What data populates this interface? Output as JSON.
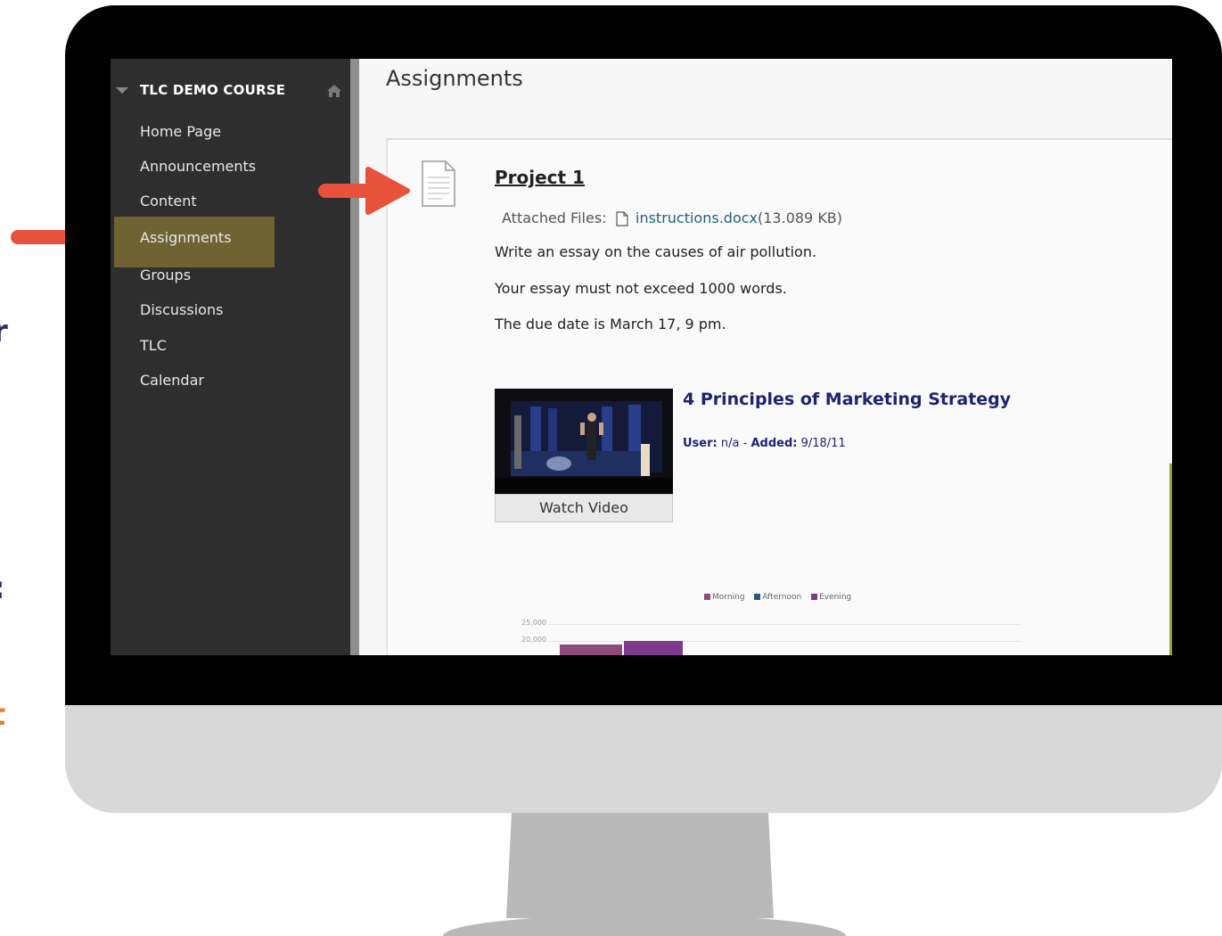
{
  "sidebar": {
    "course_title": "TLC DEMO COURSE",
    "items": [
      {
        "label": "Home Page"
      },
      {
        "label": "Announcements"
      },
      {
        "label": "Content"
      },
      {
        "label": "Assignments",
        "active": true
      },
      {
        "label": "Groups"
      },
      {
        "label": "Discussions"
      },
      {
        "label": "TLC"
      },
      {
        "label": "Calendar"
      }
    ]
  },
  "page": {
    "title": "Assignments"
  },
  "assignment": {
    "title": "Project 1",
    "attached_label": "Attached Files:",
    "file_name": "instructions.docx",
    "file_size": "(13.089 KB)",
    "paragraphs": [
      "Write an essay on the causes of air pollution.",
      "Your essay must not exceed 1000 words.",
      "The due date is March 17, 9 pm."
    ]
  },
  "video": {
    "button_label": "Watch Video",
    "title": "4 Principles of Marketing Strategy",
    "user_label": "User:",
    "user_value": "n/a",
    "added_label": "Added:",
    "added_value": "9/18/11"
  },
  "chart_data": {
    "type": "bar",
    "legend": [
      "Morning",
      "Afternoon",
      "Evening"
    ],
    "legend_colors": [
      "#8c4b78",
      "#2e5a7a",
      "#7d3a8c"
    ],
    "y_ticks": [
      "25,000",
      "20,000"
    ],
    "series": [
      {
        "name": "Morning",
        "values": [
          19000
        ]
      },
      {
        "name": "Evening",
        "values": [
          20000
        ]
      }
    ]
  },
  "edge_text": {
    "glyph_1": "r",
    "glyph_2": ":",
    "glyph_3": "t"
  },
  "colors": {
    "accent_arrow": "#e8523a",
    "active_nav": "#6f6233",
    "link": "#22617a",
    "video_title": "#1b2470"
  }
}
